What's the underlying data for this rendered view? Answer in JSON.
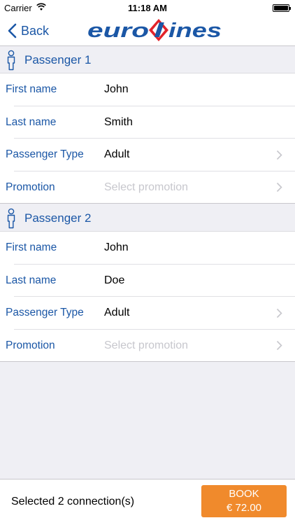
{
  "status_bar": {
    "carrier": "Carrier",
    "time": "11:18 AM"
  },
  "nav": {
    "back_label": "Back",
    "logo_text": "eurolines"
  },
  "colors": {
    "accent": "#1b57a6",
    "book_button": "#f08a2c",
    "logo_red": "#e2232a"
  },
  "passengers": [
    {
      "title": "Passenger 1",
      "fields": [
        {
          "label": "First name",
          "value": "John"
        },
        {
          "label": "Last name",
          "value": "Smith"
        },
        {
          "label": "Passenger Type",
          "value": "Adult"
        },
        {
          "label": "Promotion",
          "placeholder": "Select promotion"
        }
      ]
    },
    {
      "title": "Passenger 2",
      "fields": [
        {
          "label": "First name",
          "value": "John"
        },
        {
          "label": "Last name",
          "value": "Doe"
        },
        {
          "label": "Passenger Type",
          "value": "Adult"
        },
        {
          "label": "Promotion",
          "placeholder": "Select promotion"
        }
      ]
    }
  ],
  "footer": {
    "summary": "Selected 2 connection(s)",
    "book_label": "BOOK",
    "price": "€ 72.00"
  }
}
